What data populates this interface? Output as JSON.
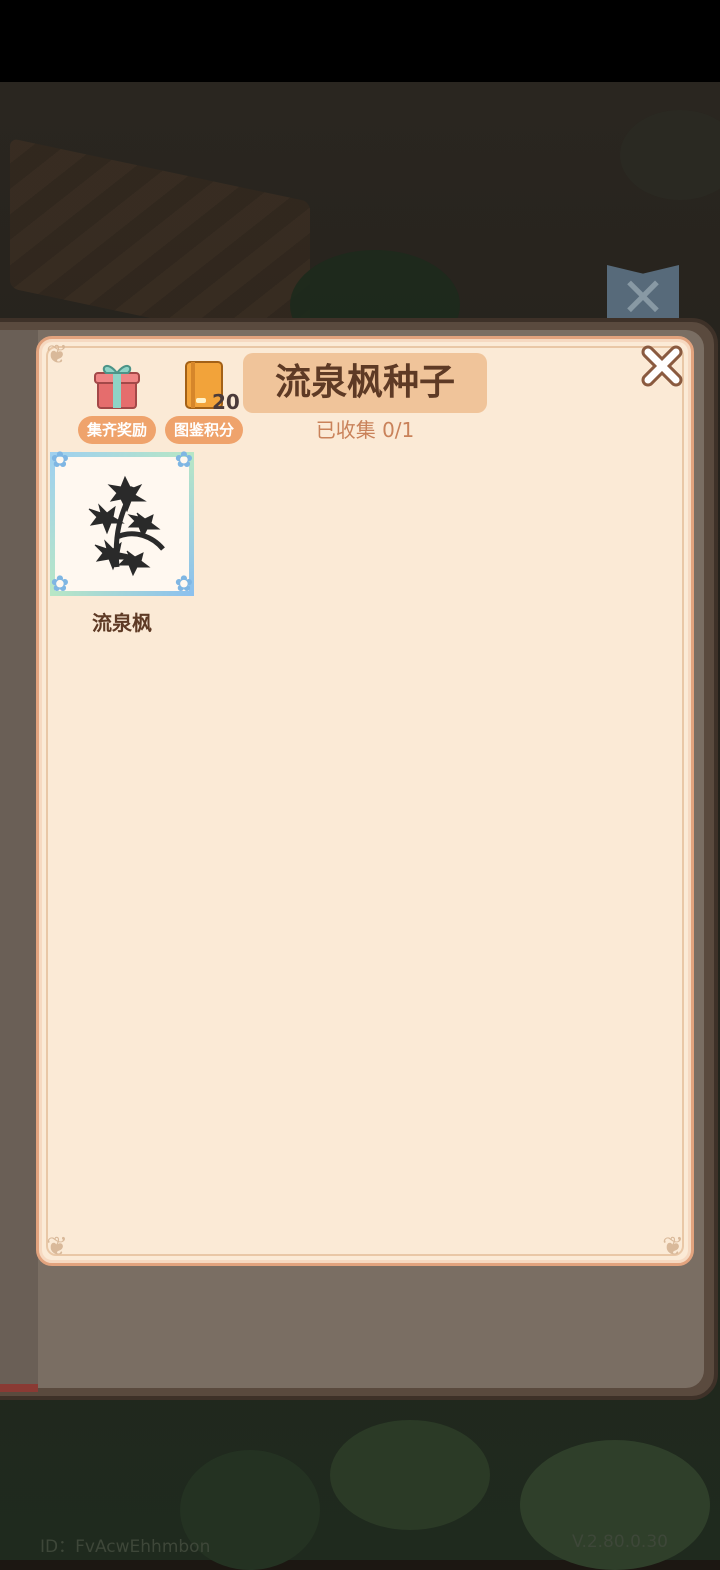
{
  "header": {
    "title": "流泉枫种子",
    "collected_label": "已收集 0/1"
  },
  "buttons": {
    "collect_reward_label": "集齐奖励",
    "codex_points_label": "图鉴积分",
    "codex_points_value": "20"
  },
  "items": [
    {
      "name": "流泉枫",
      "icon": "maple-seed-silhouette-icon"
    }
  ],
  "footer": {
    "id_text": "ID：FvAcwEhhmbon",
    "version_text": "V.2.80.0.30"
  },
  "colors": {
    "panel_bg": "#fbead6",
    "title_bg": "#f0c49a",
    "title_text": "#5e3a25",
    "pill_bg": "#efa36c",
    "collected_text": "#c9825a"
  }
}
